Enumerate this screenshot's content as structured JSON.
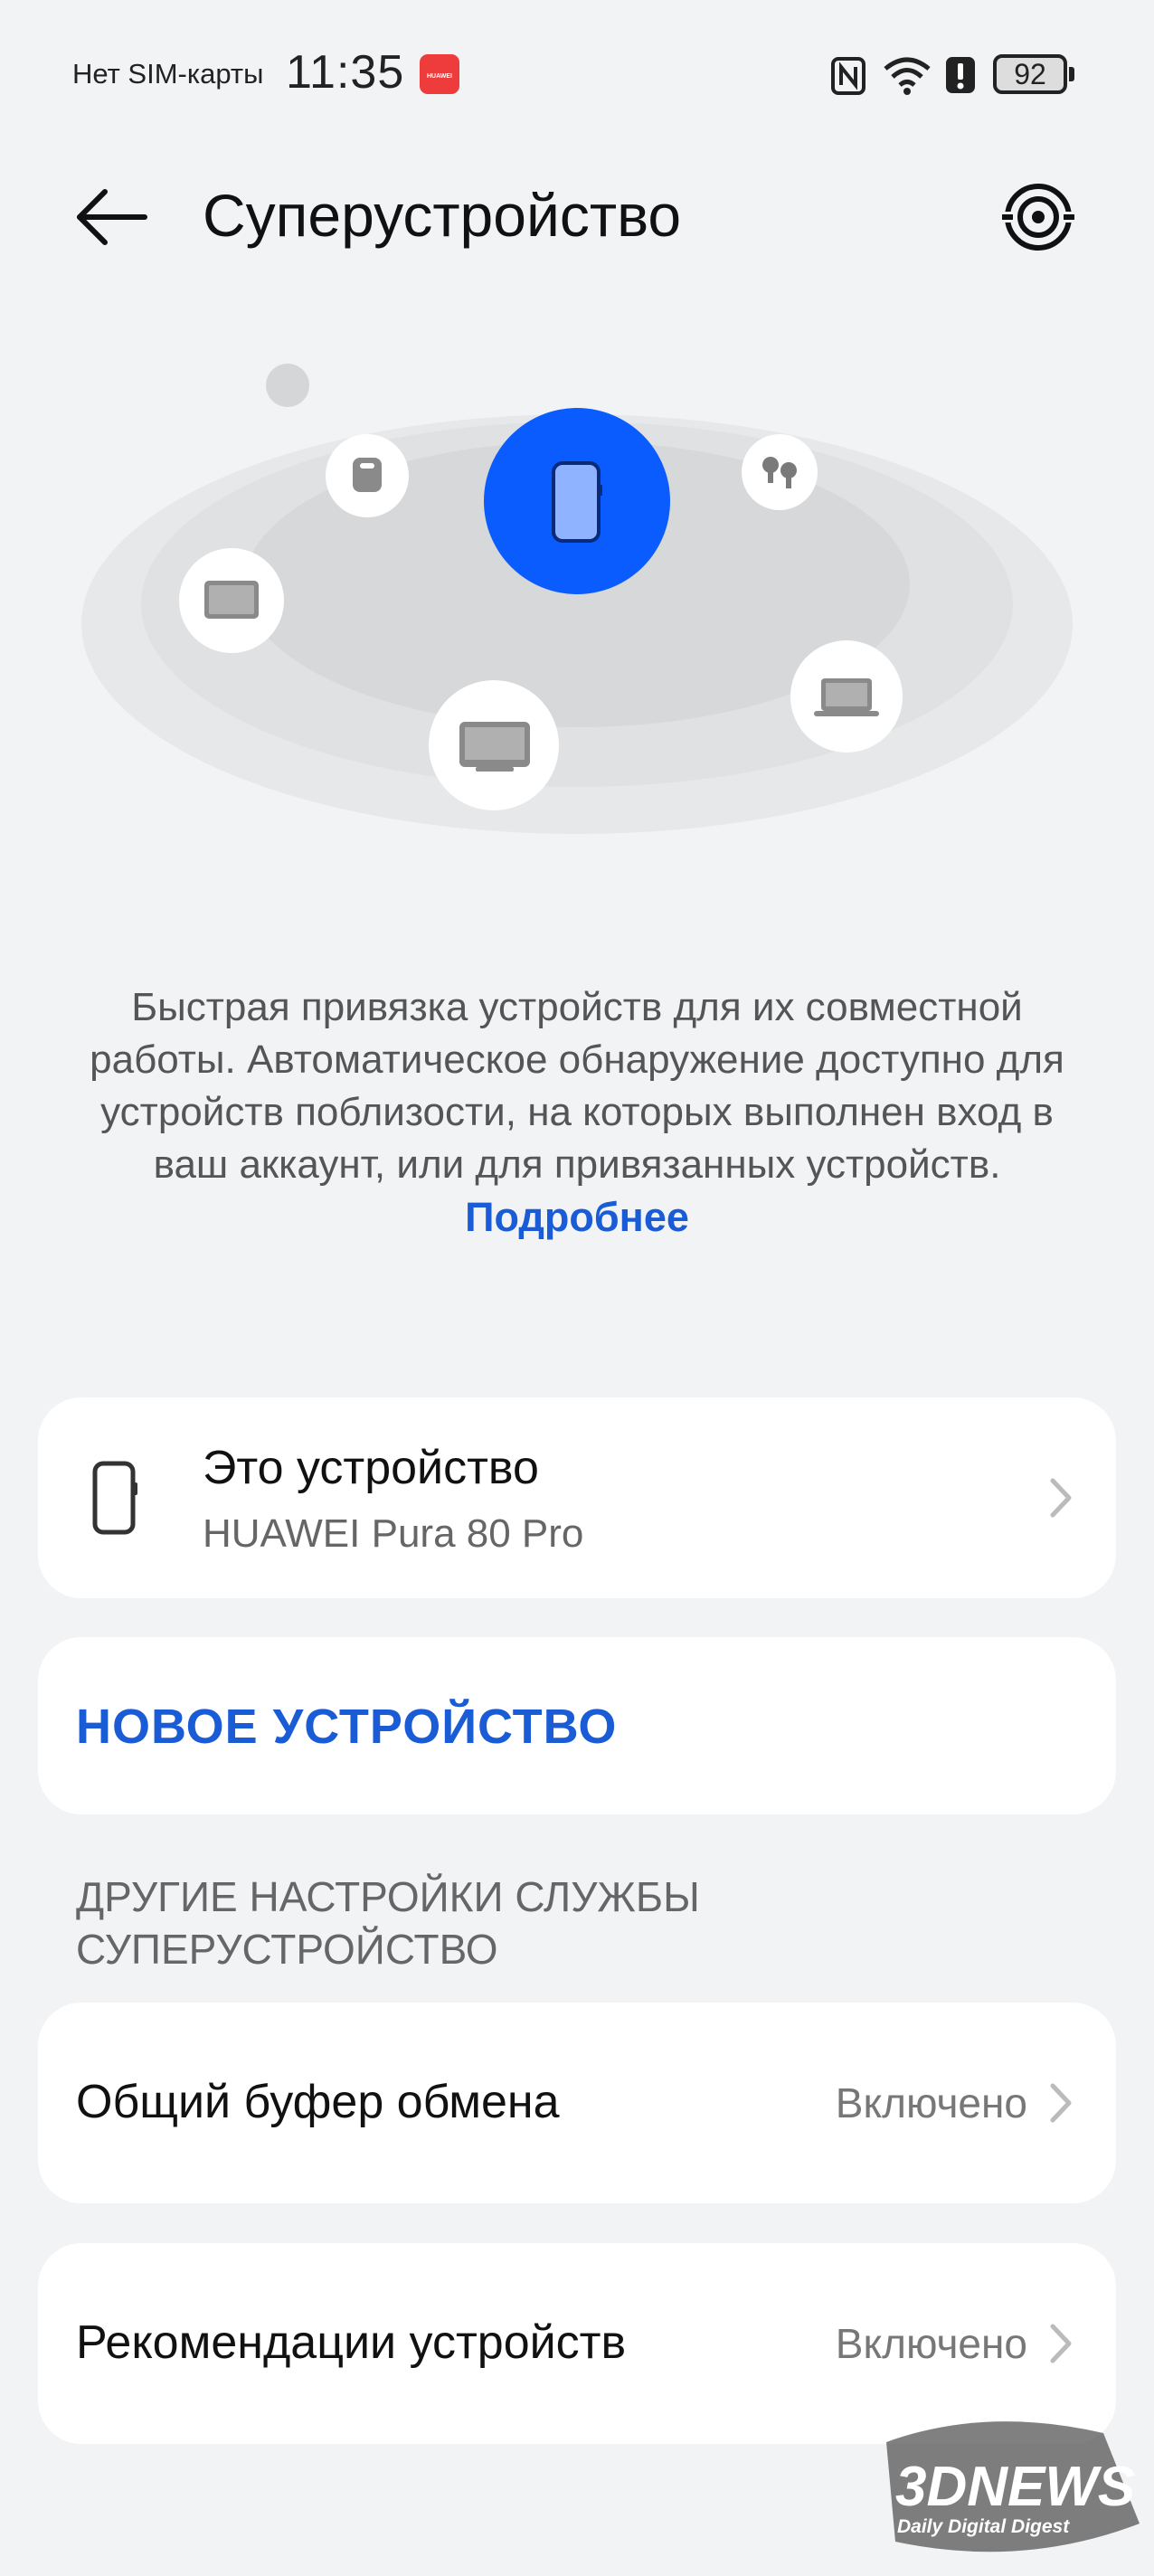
{
  "status_bar": {
    "carrier": "Нет SIM-карты",
    "time": "11:35",
    "app_badge": "HUAWEI",
    "battery": "92"
  },
  "header": {
    "title": "Суперустройство"
  },
  "description": {
    "text": "Быстрая привязка устройств для их совместной работы. Автоматическое обнаружение доступно для устройств поблизости, на которых выполнен вход в ваш аккаунт, или для привязанных устройств.",
    "link": "Подробнее"
  },
  "this_device": {
    "title": "Это устройство",
    "model": "HUAWEI Pura 80 Pro"
  },
  "new_device": {
    "label": "НОВОЕ УСТРОЙСТВО"
  },
  "other_settings": {
    "header": "ДРУГИЕ НАСТРОЙКИ СЛУЖБЫ СУПЕРУСТРОЙСТВО",
    "items": [
      {
        "label": "Общий буфер обмена",
        "value": "Включено"
      },
      {
        "label": "Рекомендации устройств",
        "value": "Включено"
      }
    ]
  },
  "watermark": {
    "brand": "3DNEWS",
    "tagline": "Daily Digital Digest"
  },
  "colors": {
    "accent": "#1a5bd6",
    "phone_bubble": "#0a5cff",
    "background": "#f1f3f5"
  }
}
